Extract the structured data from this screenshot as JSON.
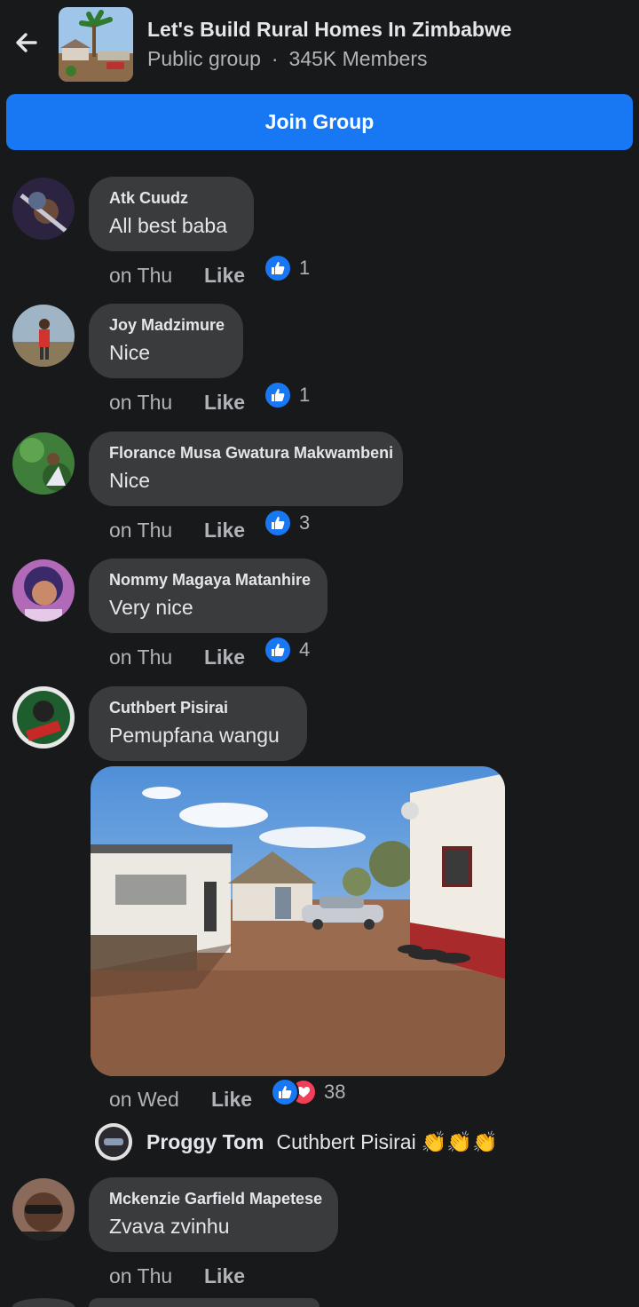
{
  "header": {
    "title": "Let's Build Rural Homes In Zimbabwe",
    "privacy": "Public group",
    "separator": "·",
    "members": "345K Members"
  },
  "join_label": "Join Group",
  "like_label": "Like",
  "comments": [
    {
      "author": "Atk Cuudz",
      "text": "All best baba",
      "time": "on Thu",
      "reactions": "1"
    },
    {
      "author": "Joy Madzimure",
      "text": "Nice",
      "time": "on Thu",
      "reactions": "1"
    },
    {
      "author": "Florance Musa Gwatura Makwambeni",
      "text": "Nice",
      "time": "on Thu",
      "reactions": "3"
    },
    {
      "author": "Nommy Magaya Matanhire",
      "text": "Very nice",
      "time": "on Thu",
      "reactions": "4"
    },
    {
      "author": "Cuthbert Pisirai",
      "text": "Pemupfana wangu",
      "time": "on Wed",
      "reactions": "38"
    },
    {
      "author": "Mckenzie Garfield Mapetese",
      "text": "Zvava zvinhu",
      "time": "on Thu"
    }
  ],
  "reply": {
    "author": "Proggy Tom",
    "text": "Cuthbert Pisirai",
    "emoji": "👏👏👏"
  },
  "colors": {
    "accent": "#1877f2",
    "bubble": "#3a3b3c",
    "background": "#18191a",
    "heart": "#f33e58"
  },
  "icons": [
    "back-arrow-icon",
    "thumbs-up-icon",
    "heart-icon",
    "clapping-hands-icon"
  ]
}
